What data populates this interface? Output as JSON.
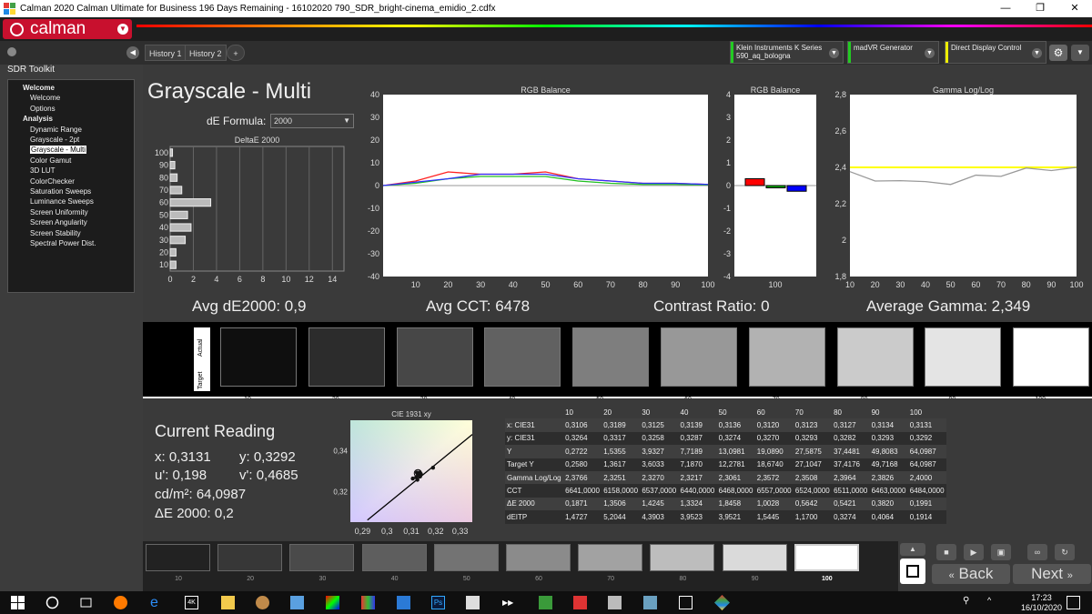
{
  "window": {
    "title": "Calman 2020 Calman Ultimate for Business 196 Days Remaining - 16102020 790_SDR_bright-cinema_emidio_2.cdfx",
    "controls": [
      "—",
      "❐",
      "✕"
    ]
  },
  "app": {
    "logo_text": "calman"
  },
  "sidebar": {
    "title": "SDR Toolkit",
    "items": [
      {
        "label": "Welcome",
        "level": 0
      },
      {
        "label": "Welcome",
        "level": 1
      },
      {
        "label": "Options",
        "level": 1
      },
      {
        "label": "Analysis",
        "level": 0
      },
      {
        "label": "Dynamic Range",
        "level": 1
      },
      {
        "label": "Grayscale - 2pt",
        "level": 1
      },
      {
        "label": "Grayscale - Multi",
        "level": 1,
        "selected": true
      },
      {
        "label": "Color Gamut",
        "level": 1
      },
      {
        "label": "3D LUT",
        "level": 1
      },
      {
        "label": "ColorChecker",
        "level": 1
      },
      {
        "label": "Saturation Sweeps",
        "level": 1
      },
      {
        "label": "Luminance Sweeps",
        "level": 1
      },
      {
        "label": "Screen Uniformity",
        "level": 1
      },
      {
        "label": "Screen Angularity",
        "level": 1
      },
      {
        "label": "Screen Stability",
        "level": 1
      },
      {
        "label": "Spectral Power Dist.",
        "level": 1
      }
    ]
  },
  "tabs": [
    "History 1",
    "History 2"
  ],
  "devices": [
    {
      "line1": "Klein Instruments K Series",
      "line2": "590_aq_bologna",
      "color": "#22cc22"
    },
    {
      "line1": "madVR Generator",
      "line2": "",
      "color": "#22cc22"
    },
    {
      "line1": "Direct Display Control",
      "line2": "",
      "color": "#eeee00"
    }
  ],
  "page": {
    "title": "Grayscale - Multi",
    "formula_label": "dE Formula:",
    "formula_value": "2000"
  },
  "stats": {
    "avg_de": "Avg dE2000: 0,9",
    "avg_cct": "Avg CCT: 6478",
    "contrast": "Contrast Ratio: 0",
    "avg_gamma": "Average Gamma: 2,349"
  },
  "chart_data": [
    {
      "type": "bar",
      "orientation": "horizontal",
      "title": "DeltaE 2000",
      "categories": [
        10,
        20,
        30,
        40,
        50,
        60,
        70,
        80,
        90,
        100
      ],
      "values": [
        0.5,
        0.5,
        1.3,
        1.8,
        1.5,
        3.5,
        1.0,
        0.6,
        0.4,
        0.2
      ],
      "xlim": [
        0,
        15
      ],
      "x_ticks": [
        0,
        2,
        4,
        6,
        8,
        10,
        12,
        14
      ]
    },
    {
      "type": "line",
      "title": "RGB Balance",
      "x": [
        0,
        10,
        20,
        30,
        40,
        50,
        60,
        70,
        80,
        90,
        100
      ],
      "x_ticks": [
        10,
        20,
        30,
        40,
        50,
        60,
        70,
        80,
        90,
        100
      ],
      "ylim": [
        -40,
        40
      ],
      "y_ticks": [
        40,
        30,
        20,
        10,
        0,
        -10,
        -20,
        -30,
        -40
      ],
      "series": [
        {
          "color": "#ff2020",
          "values": [
            0,
            2,
            6,
            5,
            5,
            6,
            3,
            2,
            1,
            1,
            0.5
          ]
        },
        {
          "color": "#20c020",
          "values": [
            0,
            1,
            3,
            4,
            4,
            4,
            2,
            1,
            0.5,
            0.5,
            0.3
          ]
        },
        {
          "color": "#3030ff",
          "values": [
            0,
            1.5,
            3,
            5,
            5,
            5,
            3,
            2,
            1,
            1,
            0.5
          ]
        }
      ]
    },
    {
      "type": "bar",
      "title": "RGB Balance",
      "categories": [
        "100"
      ],
      "ylim": [
        -4,
        4
      ],
      "y_ticks": [
        4,
        3,
        2,
        1,
        0,
        -1,
        -2,
        -3,
        -4
      ],
      "series": [
        {
          "color": "#ff0000",
          "values": [
            0.3
          ]
        },
        {
          "color": "#00aa00",
          "values": [
            -0.1
          ]
        },
        {
          "color": "#0000ff",
          "values": [
            -0.25
          ]
        }
      ]
    },
    {
      "type": "line",
      "title": "Gamma Log/Log",
      "x": [
        10,
        20,
        30,
        40,
        50,
        60,
        70,
        80,
        90,
        100
      ],
      "x_ticks": [
        10,
        20,
        30,
        40,
        50,
        60,
        70,
        80,
        90,
        100
      ],
      "ylim": [
        1.8,
        2.8
      ],
      "y_ticks": [
        2.8,
        2.6,
        2.4,
        2.2,
        2.0,
        1.8
      ],
      "y_tick_labels": [
        "2,8",
        "2,6",
        "2,4",
        "2,2",
        "2",
        "1,8"
      ],
      "series": [
        {
          "color": "#ffff00",
          "values": [
            2.4,
            2.4,
            2.4,
            2.4,
            2.4,
            2.4,
            2.4,
            2.4,
            2.4,
            2.4
          ]
        },
        {
          "color": "#9a9a9a",
          "values": [
            2.3766,
            2.3251,
            2.327,
            2.3217,
            2.3061,
            2.3572,
            2.3508,
            2.3964,
            2.3826,
            2.4
          ]
        }
      ]
    },
    {
      "type": "scatter",
      "title": "CIE 1931 xy",
      "xlim": [
        0.285,
        0.335
      ],
      "ylim": [
        0.305,
        0.355
      ],
      "x_tick_labels": [
        "0,29",
        "0,3",
        "0,31",
        "0,32",
        "0,33"
      ],
      "x_ticks": [
        0.29,
        0.3,
        0.31,
        0.32,
        0.33
      ],
      "y_tick_labels": [
        "0,34",
        "0,32"
      ],
      "y_ticks": [
        0.34,
        0.32
      ],
      "points": [
        {
          "x": 0.3106,
          "y": 0.3264
        },
        {
          "x": 0.3189,
          "y": 0.3317
        },
        {
          "x": 0.3125,
          "y": 0.3258
        },
        {
          "x": 0.3139,
          "y": 0.3287
        },
        {
          "x": 0.3136,
          "y": 0.3274
        },
        {
          "x": 0.312,
          "y": 0.327
        },
        {
          "x": 0.3123,
          "y": 0.3293
        },
        {
          "x": 0.3127,
          "y": 0.3282
        },
        {
          "x": 0.3134,
          "y": 0.3293
        },
        {
          "x": 0.3131,
          "y": 0.3292
        }
      ],
      "target": {
        "x": 0.3127,
        "y": 0.329
      }
    }
  ],
  "swatches": {
    "side_labels": [
      "Actual",
      "Target"
    ],
    "labels": [
      "10",
      "20",
      "30",
      "40",
      "50",
      "60",
      "70",
      "80",
      "90",
      "100"
    ],
    "colors": [
      "#0f0f0f",
      "#2c2c2c",
      "#474747",
      "#616161",
      "#7e7e7e",
      "#989898",
      "#b2b2b2",
      "#cbcbcb",
      "#e4e4e4",
      "#ffffff"
    ]
  },
  "current_reading": {
    "title": "Current Reading",
    "x": "x: 0,3131",
    "y": "y: 0,3292",
    "u": "u': 0,198",
    "v": "v': 0,4685",
    "cd": "cd/m²: 64,0987",
    "de": "ΔE 2000: 0,2"
  },
  "table": {
    "headers": [
      "",
      "10",
      "20",
      "30",
      "40",
      "50",
      "60",
      "70",
      "80",
      "90",
      "100"
    ],
    "rows": [
      [
        "x: CIE31",
        "0,3106",
        "0,3189",
        "0,3125",
        "0,3139",
        "0,3136",
        "0,3120",
        "0,3123",
        "0,3127",
        "0,3134",
        "0,3131"
      ],
      [
        "y: CIE31",
        "0,3264",
        "0,3317",
        "0,3258",
        "0,3287",
        "0,3274",
        "0,3270",
        "0,3293",
        "0,3282",
        "0,3293",
        "0,3292"
      ],
      [
        "Y",
        "0,2722",
        "1,5355",
        "3,9327",
        "7,7189",
        "13,0981",
        "19,0890",
        "27,5875",
        "37,4481",
        "49,8083",
        "64,0987"
      ],
      [
        "Target Y",
        "0,2580",
        "1,3617",
        "3,6033",
        "7,1870",
        "12,2781",
        "18,6740",
        "27,1047",
        "37,4176",
        "49,7168",
        "64,0987"
      ],
      [
        "Gamma Log/Log",
        "2,3766",
        "2,3251",
        "2,3270",
        "2,3217",
        "2,3061",
        "2,3572",
        "2,3508",
        "2,3964",
        "2,3826",
        "2,4000"
      ],
      [
        "CCT",
        "6641,0000",
        "6158,0000",
        "6537,0000",
        "6440,0000",
        "6468,0000",
        "6557,0000",
        "6524,0000",
        "6511,0000",
        "6463,0000",
        "6484,0000"
      ],
      [
        "ΔE 2000",
        "0,1871",
        "1,3506",
        "1,4245",
        "1,3324",
        "1,8458",
        "1,0028",
        "0,5642",
        "0,5421",
        "0,3820",
        "0,1991"
      ],
      [
        "dEITP",
        "1,4727",
        "5,2044",
        "4,3903",
        "3,9523",
        "3,9521",
        "1,5445",
        "1,1700",
        "0,3274",
        "0,4064",
        "0,1914"
      ]
    ]
  },
  "footer": {
    "labels": [
      "10",
      "20",
      "30",
      "40",
      "50",
      "60",
      "70",
      "80",
      "90",
      "100"
    ],
    "colors": [
      "#222222",
      "#373737",
      "#4a4a4a",
      "#5e5e5e",
      "#737373",
      "#8b8b8b",
      "#a2a2a2",
      "#bdbdbd",
      "#dadada",
      "#ffffff"
    ],
    "back_label": "Back",
    "next_label": "Next"
  },
  "taskbar": {
    "time": "17:23",
    "date": "16/10/2020"
  }
}
